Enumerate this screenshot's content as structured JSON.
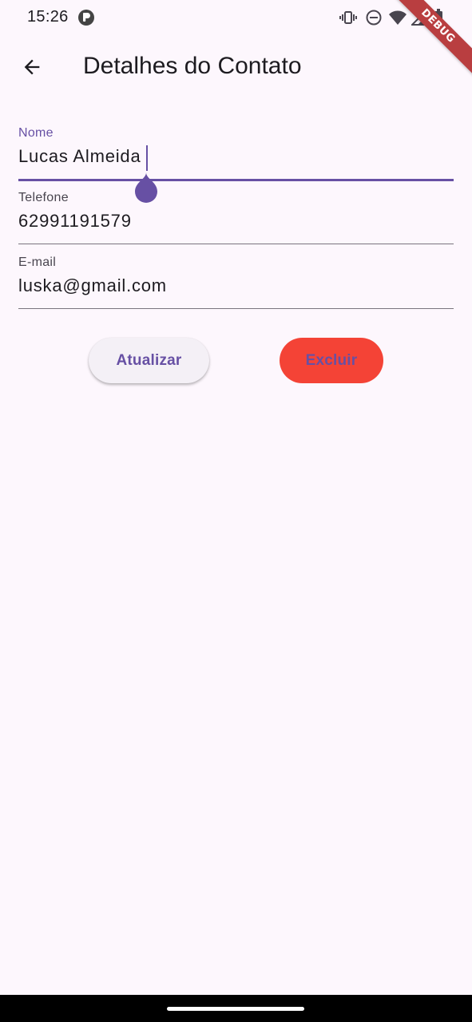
{
  "status_bar": {
    "time": "15:26",
    "icons": [
      "app-notification-icon",
      "vibrate-icon",
      "do-not-disturb-icon",
      "wifi-icon",
      "cell-signal-icon",
      "battery-icon"
    ]
  },
  "debug_banner": "DEBUG",
  "app_bar": {
    "back_icon": "arrow-back-icon",
    "title": "Detalhes do Contato"
  },
  "form": {
    "nome": {
      "label": "Nome",
      "value": "Lucas Almeida",
      "focused": true
    },
    "telefone": {
      "label": "Telefone",
      "value": "62991191579"
    },
    "email": {
      "label": "E-mail",
      "value": "luska@gmail.com"
    }
  },
  "actions": {
    "update_label": "Atualizar",
    "delete_label": "Excluir"
  },
  "colors": {
    "background": "#FDF7FD",
    "primary": "#6750A4",
    "delete_button": "#F44336",
    "update_button": "#F4F0F6",
    "debug_banner": "#B93E40"
  }
}
